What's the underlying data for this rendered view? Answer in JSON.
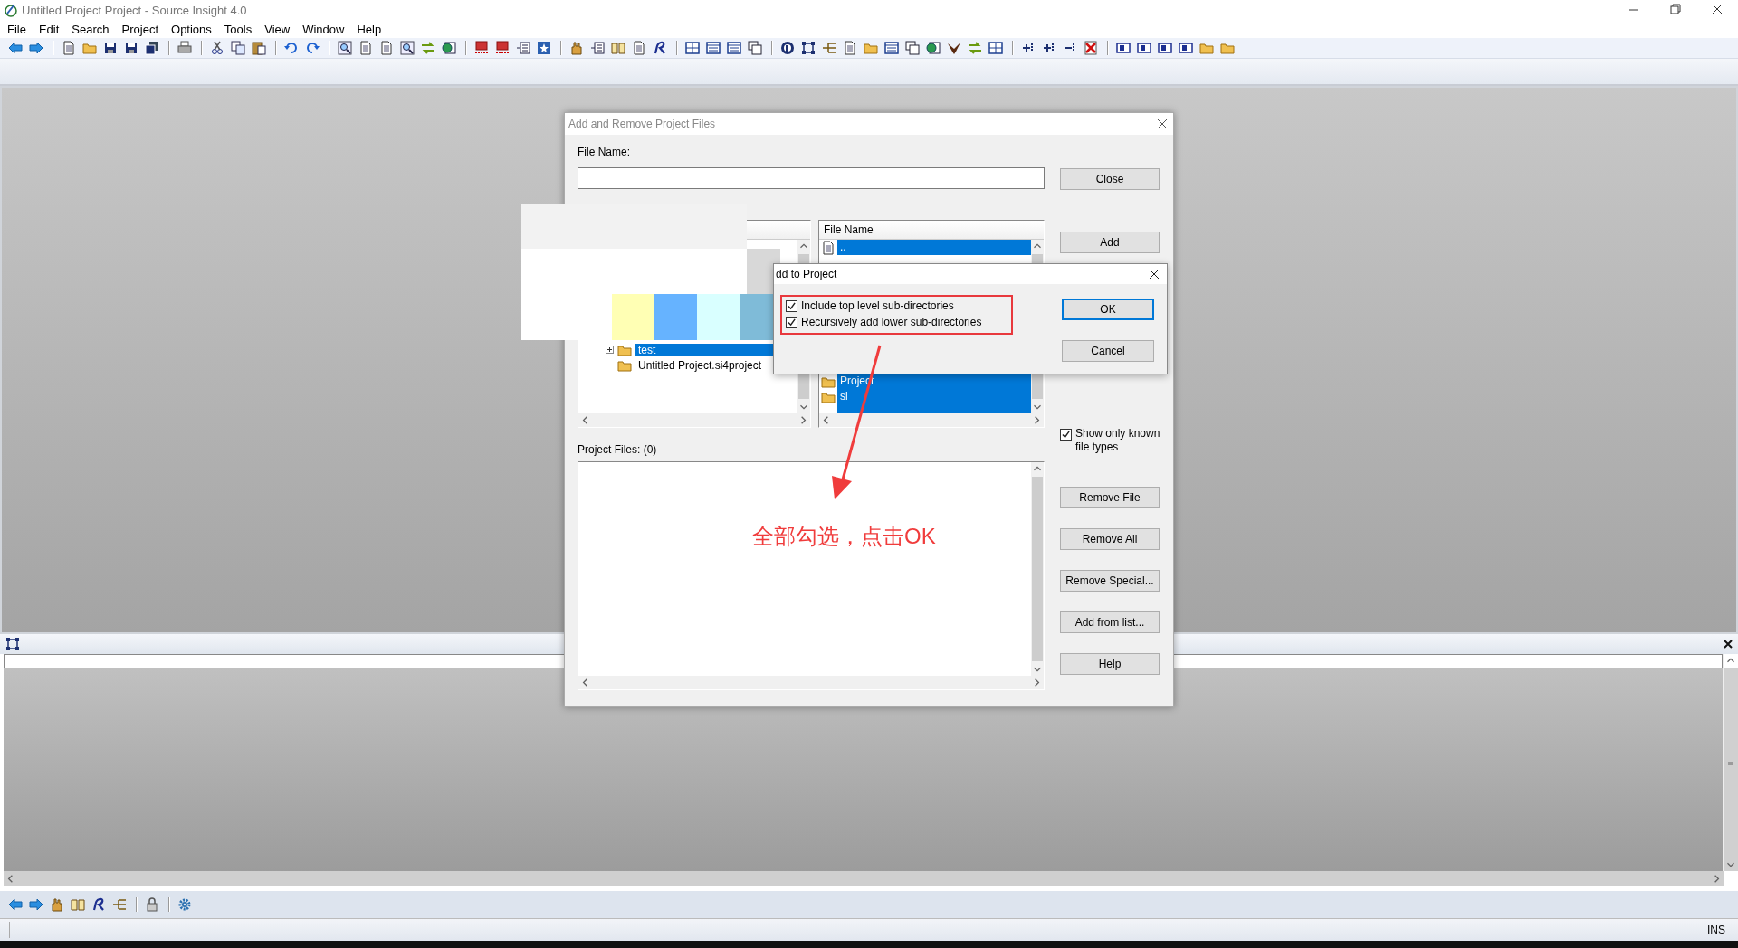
{
  "window": {
    "title": "Untitled Project Project - Source Insight 4.0"
  },
  "menu": [
    "File",
    "Edit",
    "Search",
    "Project",
    "Options",
    "Tools",
    "View",
    "Window",
    "Help"
  ],
  "dialog": {
    "title": "Add and Remove Project Files",
    "file_name_label": "File Name:",
    "tree": [
      {
        "label": "test",
        "kind": "collapsible",
        "selected": true
      },
      {
        "label": "Untitled Project.si4project",
        "kind": "leaf",
        "selected": false
      }
    ],
    "file_list": {
      "header": "File Name",
      "rows_top": [
        {
          "label": "..",
          "kind": "file",
          "selected": true
        }
      ],
      "rows_bottom": [
        {
          "label": "Project",
          "kind": "folder",
          "selected": true
        },
        {
          "label": "si",
          "kind": "folder",
          "selected": true
        }
      ]
    },
    "buttons_top": [
      "Close",
      "Add"
    ],
    "show_known": {
      "label": "Show only known file types",
      "checked": true
    },
    "buttons_bottom": [
      "Remove File",
      "Remove All",
      "Remove Special...",
      "Add from list...",
      "Help"
    ],
    "project_files_label": "Project Files: (0)"
  },
  "subdialog": {
    "title": "dd to Project",
    "options": [
      {
        "label": "Include top level sub-directories",
        "checked": true
      },
      {
        "label": "Recursively add lower sub-directories",
        "checked": true
      }
    ],
    "buttons": [
      {
        "label": "OK",
        "default": true
      },
      {
        "label": "Cancel",
        "default": false
      }
    ]
  },
  "annotation": {
    "text": "全部勾选，点击OK"
  },
  "status_bar": {
    "mode": "INS"
  }
}
